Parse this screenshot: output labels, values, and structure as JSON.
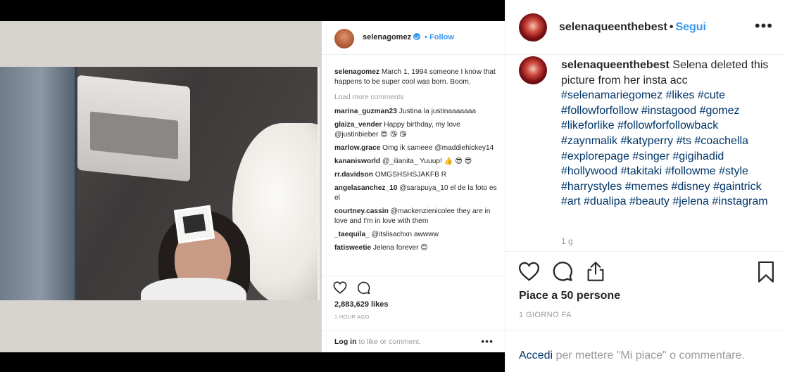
{
  "embedded_post": {
    "username": "selenagomez",
    "follow_label": "Follow",
    "caption_user": "selenagomez",
    "caption_text": " March 1, 1994 someone I know that happens to be super cool was born. Boom.",
    "load_more": "Load more comments",
    "comments": [
      {
        "user": "marina_guzman23",
        "text": " Justina la justinaaaaaaa"
      },
      {
        "user": "glaiza_vender",
        "text": " Happy birthday, my love @justinbieber 😍 😘 😘"
      },
      {
        "user": "marlow.grace",
        "text": " Omg ik sameee @maddiehickey14"
      },
      {
        "user": "kananisworld",
        "text": " @_ilianita_ Yuuup! 👍 😎 😎"
      },
      {
        "user": "rr.davidson",
        "text": " OMGSHSHSJAKFB R"
      },
      {
        "user": "angelasanchez_10",
        "text": " @sarapuya_10 el de la foto es el"
      },
      {
        "user": "courtney.cassin",
        "text": " @mackenzienicolee they are in love and I'm in love with them"
      },
      {
        "user": "_taequila_",
        "text": " @itslisachxn awwww"
      },
      {
        "user": "fatisweetie",
        "text": " Jelena forever 😊"
      }
    ],
    "likes": "2,883,629 likes",
    "time": "1 HOUR AGO",
    "login_bold": "Log in",
    "login_rest": " to like or comment.",
    "more": "•••"
  },
  "sidebar": {
    "username": "selenaqueenthebest",
    "dot": "•",
    "follow_label": "Segui",
    "more": "•••",
    "comment_user": "selenaqueenthebest",
    "comment_text": " Selena deleted this picture from her insta acc ",
    "hashtags": "#selenamariegomez #likes #cute #followforfollow #instagood #gomez #likeforlike #followforfollowback #zaynmalik #katyperry #ts #coachella #explorepage #singer #gigihadid #hollywood #takitaki #followme #style #harrystyles #memes #disney #gaintrick #art #dualipa #beauty #jelena #instagram",
    "comment_age": "1 g",
    "likes": "Piace a 50 persone",
    "date": "1 GIORNO FA",
    "login_link": "Accedi",
    "login_rest": " per mettere \"Mi piace\" o commentare."
  },
  "icons": {
    "heart": "heart-icon",
    "comment": "comment-icon",
    "share": "share-icon",
    "save": "bookmark-icon"
  },
  "colors": {
    "accent": "#3897f0",
    "link": "#003569",
    "muted": "#999999",
    "text": "#262626"
  }
}
